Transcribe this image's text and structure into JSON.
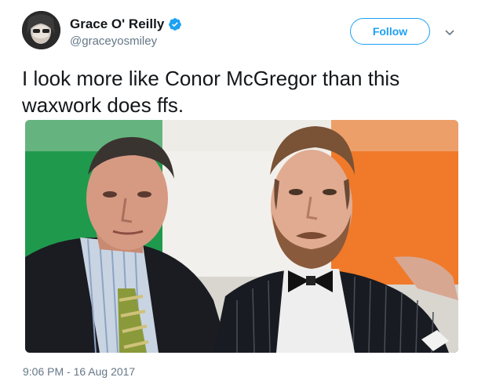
{
  "user": {
    "display_name": "Grace O' Reilly",
    "handle": "@graceyosmiley",
    "verified_icon": "verified-badge-icon",
    "verified_color": "#1da1f2"
  },
  "actions": {
    "follow_label": "Follow",
    "more_icon": "chevron-down-icon"
  },
  "tweet": {
    "text": "I look more like Conor McGregor than this waxwork does ffs.",
    "timestamp": "9:06 PM - 16 Aug 2017"
  },
  "media": {
    "description_icon": "photo",
    "flag_colors": [
      "#169b62",
      "#ffffff",
      "#ff883e"
    ]
  },
  "colors": {
    "accent": "#1da1f2",
    "text": "#14171a",
    "muted": "#657786"
  }
}
